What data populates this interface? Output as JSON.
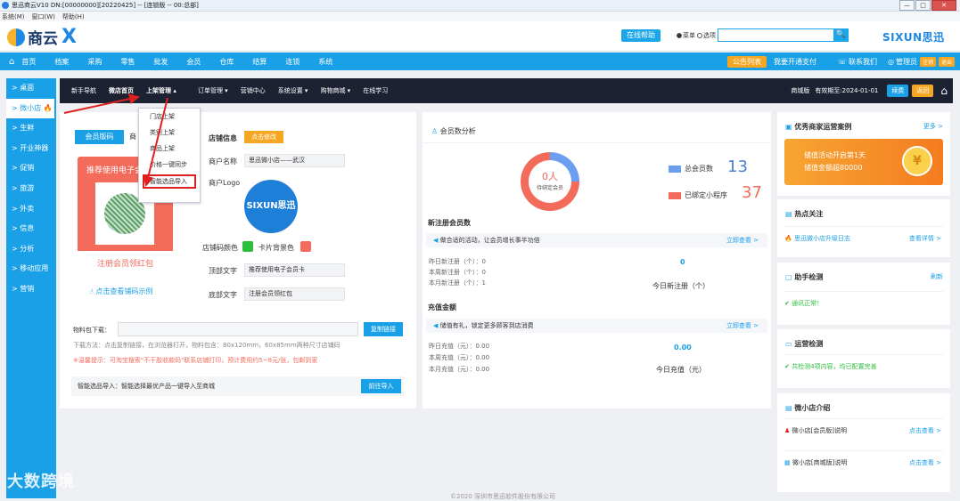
{
  "window": {
    "title": "思迅商云V10 DN:[00000000][20220425] -- [连锁版 -- 00:总部]",
    "min": "—",
    "max": "□",
    "close": "✕"
  },
  "menubar": [
    "系统(M)",
    "窗口(W)",
    "帮助(H)"
  ],
  "header": {
    "logo_text": "商云",
    "logo_x": "X",
    "help_label": "在线帮助",
    "radio_menu": "菜单",
    "radio_option": "选项",
    "search_btn": "🔍",
    "brand": "SIXUN思迅"
  },
  "topnav": {
    "items": [
      "首页",
      "档案",
      "采购",
      "零售",
      "批发",
      "会员",
      "仓库",
      "结算",
      "连锁",
      "系统"
    ],
    "notice_tag": "公告列表",
    "notice_text": "我要开通支付",
    "contact": "联系我们",
    "admin": "管理员",
    "tag1": "注销",
    "tag2": "退出"
  },
  "sidebar": [
    "> 桌面",
    "> 微小店",
    "> 生鲜",
    "> 开业神器",
    "> 促销",
    "> 旅游",
    "> 外卖",
    "> 信息",
    "> 分析",
    "> 移动应用",
    "> 营销"
  ],
  "darknav": {
    "items": [
      "新手导航",
      "微店首页",
      "上架管理 ▴",
      "订单管理 ▾",
      "营销中心",
      "系统设置 ▾",
      "购物商城 ▾",
      "在线学习"
    ],
    "shop_label": "商城版",
    "expire": "有效期至:2024-01-01",
    "renew": "续费",
    "back": "返回"
  },
  "dropdown": [
    "门店上架",
    "类别上架",
    "商品上架",
    "价格一键同步",
    "智能选品导入"
  ],
  "shop": {
    "tab_member": "会员版码",
    "tab_other": "商",
    "card_title": "推荐使用电子会",
    "card_bottom": "注册会员领红包",
    "see_example": "点击查看铺码示例",
    "info_title": "店铺信息",
    "edit_btn": "点击修改",
    "name_label": "商户名称",
    "name_value": "思迅微小店——武汉",
    "logo_label": "商户Logo",
    "logo_text": "SIXUN思迅",
    "color_label": "店铺码颜色",
    "bg_label": "卡片背景色",
    "top_label": "顶部文字",
    "top_value": "推荐使用电子会员卡",
    "bottom_label": "底部文字",
    "bottom_value": "注册会员领红包",
    "download_label": "物料包下载：",
    "copy_btn": "复制链接",
    "download_hint": "下载方法：点击复制链接，在浏览器打开，物料包含：80x120mm，60x85mm两种尺寸店铺码",
    "warm_hint": "※温馨提示：可淘宝搜索\"不干胶收款码\"联系店铺打印，预计费用约5~8元/张，包邮到家",
    "smart_text": "智能选品导入：智能选择最优产品一键导入至商城",
    "go_btn": "前往导入",
    "colors": {
      "green": "#2bbf3c",
      "red": "#f36b5b"
    }
  },
  "member": {
    "title": "会员数分析",
    "donut_num": "0人",
    "donut_sub": "待绑定会员",
    "total_label": "总会员数",
    "total_value": "13",
    "bound_label": "已绑定小程序",
    "bound_value": "37",
    "new_title": "新注册会员数",
    "new_bar": "做合适的活动，让会员增长事半功倍",
    "new_link": "立即查看 >",
    "new_rows": [
      "昨日新注册（个）：0",
      "本周新注册（个）：0",
      "本月新注册（个）：1"
    ],
    "new_today_num": "0",
    "new_today_label": "今日新注册（个）",
    "recharge_title": "充值金额",
    "recharge_bar": "储值有礼，锁定更多顾客到店消费",
    "recharge_link": "立即查看 >",
    "recharge_rows": [
      "昨日充值（元）：0.00",
      "本周充值（元）：0.00",
      "本月充值（元）：0.00"
    ],
    "recharge_today_num": "0.00",
    "recharge_today_label": "今日充值（元）"
  },
  "right": {
    "case_title": "优秀商家运营案例",
    "case_more": "更多 >",
    "banner_l1": "储值活动开启第1天",
    "banner_l2": "储值金额超80000",
    "banner_coin": "¥",
    "hot_title": "热点关注",
    "hot_item": "思迅微小店升级日志",
    "hot_link": "查看详情 >",
    "check_title": "助手检测",
    "check_refresh": "刷新",
    "check_item": "通讯正常！",
    "ops_title": "运营检测",
    "ops_item": "共检测4项内容，均已配置完善",
    "intro_title": "微小店介绍",
    "intro_items": [
      "微小店[会员版]说明",
      "微小店[商城版]说明"
    ],
    "intro_link": "点击查看 >"
  },
  "footer": "©2020 深圳市思迅软件股份有限公司",
  "watermark": "大数跨境"
}
